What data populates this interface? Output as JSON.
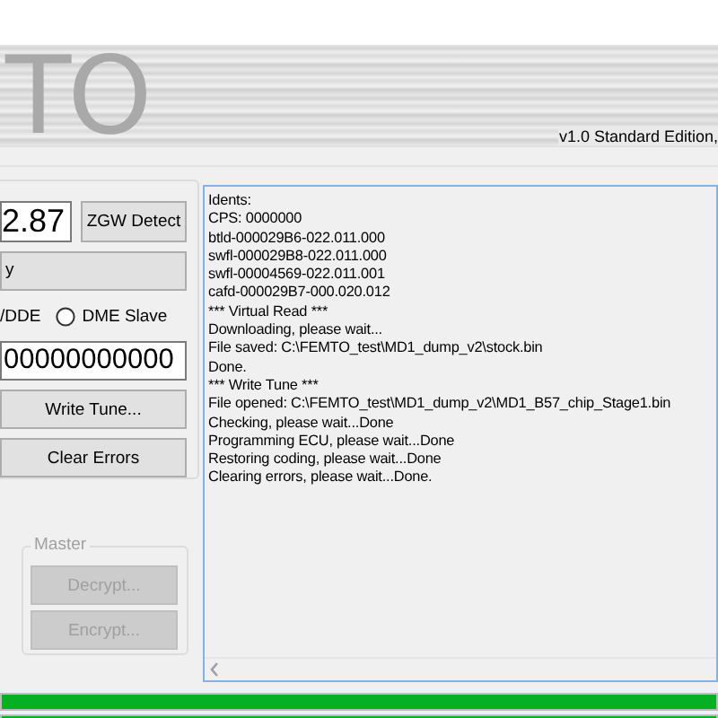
{
  "banner": {
    "logo": "TO",
    "version": "v1.0 Standard Edition,"
  },
  "left_panel": {
    "value_field": {
      "value": "2.87"
    },
    "detect_button": {
      "label": "ZGW Detect",
      "disabled": false
    },
    "wide_button": {
      "label": "y",
      "disabled": false
    },
    "mode_label": "/DDE",
    "dme_slave": {
      "label": "DME Slave",
      "selected": false
    },
    "serial_field": {
      "value": "00000000000"
    },
    "actions": [
      {
        "label": "Write Tune...",
        "disabled": false
      },
      {
        "label": "Clear Errors",
        "disabled": false
      }
    ]
  },
  "master_group": {
    "title": "Master",
    "buttons": [
      {
        "label": "Decrypt...",
        "disabled": true
      },
      {
        "label": "Encrypt...",
        "disabled": true
      }
    ]
  },
  "log": {
    "lines": [
      "Idents:",
      "CPS: 0000000",
      "btld-000029B6-022.011.000",
      "swfl-000029B8-022.011.000",
      "swfl-00004569-022.011.001",
      "cafd-000029B7-000.020.012",
      "*** Virtual Read ***",
      "Downloading, please wait...",
      "File saved: C:\\FEMTO_test\\MD1_dump_v2\\stock.bin",
      "Done.",
      "*** Write Tune ***",
      "File opened: C:\\FEMTO_test\\MD1_dump_v2\\MD1_B57_chip_Stage1.bin",
      "Checking, please wait...Done",
      "Programming ECU, please wait...Done",
      "Restoring coding, please wait...Done",
      "Clearing errors, please wait...Done."
    ]
  },
  "progress_bars": [
    {
      "level": 1
    },
    {
      "level": 1
    }
  ]
}
